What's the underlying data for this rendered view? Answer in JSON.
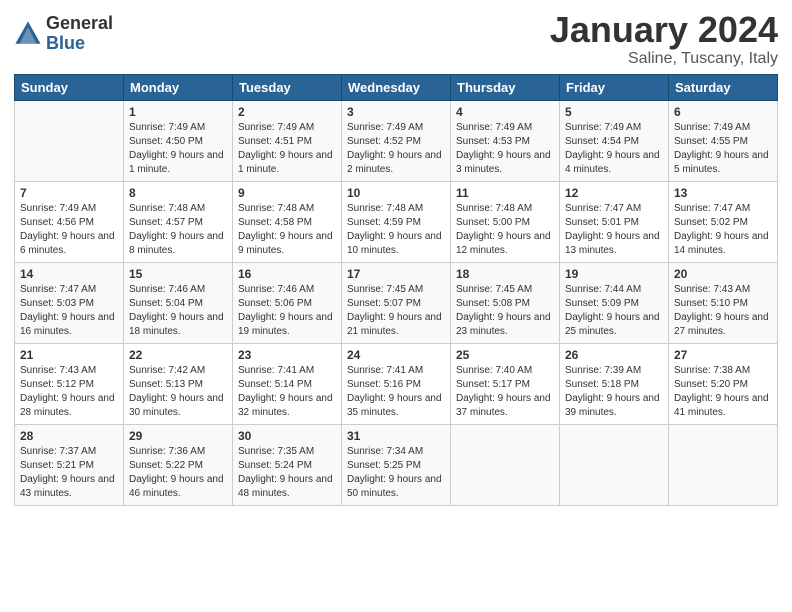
{
  "header": {
    "logo_general": "General",
    "logo_blue": "Blue",
    "month_title": "January 2024",
    "location": "Saline, Tuscany, Italy"
  },
  "days_of_week": [
    "Sunday",
    "Monday",
    "Tuesday",
    "Wednesday",
    "Thursday",
    "Friday",
    "Saturday"
  ],
  "weeks": [
    [
      {
        "day": "",
        "sunrise": "",
        "sunset": "",
        "daylight": ""
      },
      {
        "day": "1",
        "sunrise": "Sunrise: 7:49 AM",
        "sunset": "Sunset: 4:50 PM",
        "daylight": "Daylight: 9 hours and 1 minute."
      },
      {
        "day": "2",
        "sunrise": "Sunrise: 7:49 AM",
        "sunset": "Sunset: 4:51 PM",
        "daylight": "Daylight: 9 hours and 1 minute."
      },
      {
        "day": "3",
        "sunrise": "Sunrise: 7:49 AM",
        "sunset": "Sunset: 4:52 PM",
        "daylight": "Daylight: 9 hours and 2 minutes."
      },
      {
        "day": "4",
        "sunrise": "Sunrise: 7:49 AM",
        "sunset": "Sunset: 4:53 PM",
        "daylight": "Daylight: 9 hours and 3 minutes."
      },
      {
        "day": "5",
        "sunrise": "Sunrise: 7:49 AM",
        "sunset": "Sunset: 4:54 PM",
        "daylight": "Daylight: 9 hours and 4 minutes."
      },
      {
        "day": "6",
        "sunrise": "Sunrise: 7:49 AM",
        "sunset": "Sunset: 4:55 PM",
        "daylight": "Daylight: 9 hours and 5 minutes."
      }
    ],
    [
      {
        "day": "7",
        "sunrise": "Sunrise: 7:49 AM",
        "sunset": "Sunset: 4:56 PM",
        "daylight": "Daylight: 9 hours and 6 minutes."
      },
      {
        "day": "8",
        "sunrise": "Sunrise: 7:48 AM",
        "sunset": "Sunset: 4:57 PM",
        "daylight": "Daylight: 9 hours and 8 minutes."
      },
      {
        "day": "9",
        "sunrise": "Sunrise: 7:48 AM",
        "sunset": "Sunset: 4:58 PM",
        "daylight": "Daylight: 9 hours and 9 minutes."
      },
      {
        "day": "10",
        "sunrise": "Sunrise: 7:48 AM",
        "sunset": "Sunset: 4:59 PM",
        "daylight": "Daylight: 9 hours and 10 minutes."
      },
      {
        "day": "11",
        "sunrise": "Sunrise: 7:48 AM",
        "sunset": "Sunset: 5:00 PM",
        "daylight": "Daylight: 9 hours and 12 minutes."
      },
      {
        "day": "12",
        "sunrise": "Sunrise: 7:47 AM",
        "sunset": "Sunset: 5:01 PM",
        "daylight": "Daylight: 9 hours and 13 minutes."
      },
      {
        "day": "13",
        "sunrise": "Sunrise: 7:47 AM",
        "sunset": "Sunset: 5:02 PM",
        "daylight": "Daylight: 9 hours and 14 minutes."
      }
    ],
    [
      {
        "day": "14",
        "sunrise": "Sunrise: 7:47 AM",
        "sunset": "Sunset: 5:03 PM",
        "daylight": "Daylight: 9 hours and 16 minutes."
      },
      {
        "day": "15",
        "sunrise": "Sunrise: 7:46 AM",
        "sunset": "Sunset: 5:04 PM",
        "daylight": "Daylight: 9 hours and 18 minutes."
      },
      {
        "day": "16",
        "sunrise": "Sunrise: 7:46 AM",
        "sunset": "Sunset: 5:06 PM",
        "daylight": "Daylight: 9 hours and 19 minutes."
      },
      {
        "day": "17",
        "sunrise": "Sunrise: 7:45 AM",
        "sunset": "Sunset: 5:07 PM",
        "daylight": "Daylight: 9 hours and 21 minutes."
      },
      {
        "day": "18",
        "sunrise": "Sunrise: 7:45 AM",
        "sunset": "Sunset: 5:08 PM",
        "daylight": "Daylight: 9 hours and 23 minutes."
      },
      {
        "day": "19",
        "sunrise": "Sunrise: 7:44 AM",
        "sunset": "Sunset: 5:09 PM",
        "daylight": "Daylight: 9 hours and 25 minutes."
      },
      {
        "day": "20",
        "sunrise": "Sunrise: 7:43 AM",
        "sunset": "Sunset: 5:10 PM",
        "daylight": "Daylight: 9 hours and 27 minutes."
      }
    ],
    [
      {
        "day": "21",
        "sunrise": "Sunrise: 7:43 AM",
        "sunset": "Sunset: 5:12 PM",
        "daylight": "Daylight: 9 hours and 28 minutes."
      },
      {
        "day": "22",
        "sunrise": "Sunrise: 7:42 AM",
        "sunset": "Sunset: 5:13 PM",
        "daylight": "Daylight: 9 hours and 30 minutes."
      },
      {
        "day": "23",
        "sunrise": "Sunrise: 7:41 AM",
        "sunset": "Sunset: 5:14 PM",
        "daylight": "Daylight: 9 hours and 32 minutes."
      },
      {
        "day": "24",
        "sunrise": "Sunrise: 7:41 AM",
        "sunset": "Sunset: 5:16 PM",
        "daylight": "Daylight: 9 hours and 35 minutes."
      },
      {
        "day": "25",
        "sunrise": "Sunrise: 7:40 AM",
        "sunset": "Sunset: 5:17 PM",
        "daylight": "Daylight: 9 hours and 37 minutes."
      },
      {
        "day": "26",
        "sunrise": "Sunrise: 7:39 AM",
        "sunset": "Sunset: 5:18 PM",
        "daylight": "Daylight: 9 hours and 39 minutes."
      },
      {
        "day": "27",
        "sunrise": "Sunrise: 7:38 AM",
        "sunset": "Sunset: 5:20 PM",
        "daylight": "Daylight: 9 hours and 41 minutes."
      }
    ],
    [
      {
        "day": "28",
        "sunrise": "Sunrise: 7:37 AM",
        "sunset": "Sunset: 5:21 PM",
        "daylight": "Daylight: 9 hours and 43 minutes."
      },
      {
        "day": "29",
        "sunrise": "Sunrise: 7:36 AM",
        "sunset": "Sunset: 5:22 PM",
        "daylight": "Daylight: 9 hours and 46 minutes."
      },
      {
        "day": "30",
        "sunrise": "Sunrise: 7:35 AM",
        "sunset": "Sunset: 5:24 PM",
        "daylight": "Daylight: 9 hours and 48 minutes."
      },
      {
        "day": "31",
        "sunrise": "Sunrise: 7:34 AM",
        "sunset": "Sunset: 5:25 PM",
        "daylight": "Daylight: 9 hours and 50 minutes."
      },
      {
        "day": "",
        "sunrise": "",
        "sunset": "",
        "daylight": ""
      },
      {
        "day": "",
        "sunrise": "",
        "sunset": "",
        "daylight": ""
      },
      {
        "day": "",
        "sunrise": "",
        "sunset": "",
        "daylight": ""
      }
    ]
  ]
}
